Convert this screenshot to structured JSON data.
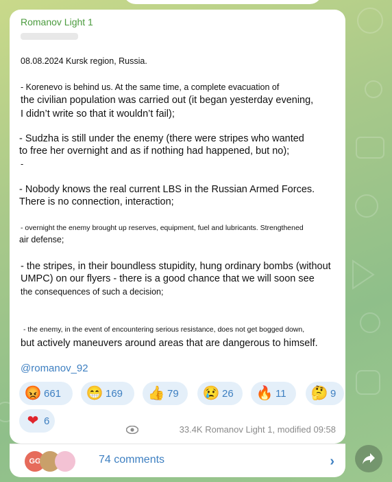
{
  "author": "Romanov Light 1",
  "lines": [
    {
      "text": "08.08.2024 Kursk region, Russia.",
      "size": "s12"
    },
    {
      "text": "- Korenevo is behind us. At the same time, a complete evacuation of",
      "size": "s12"
    },
    {
      "text": "the civilian population was carried out (it began yesterday evening,",
      "size": "s14"
    },
    {
      "text": "I didn’t write so that it wouldn’t fail);",
      "size": "s14"
    },
    {
      "text": "- Sudzha is still under the enemy (there were stripes who wanted",
      "size": "s14"
    },
    {
      "text": "to free her overnight and as if nothing had happened, but no);",
      "size": "s14"
    },
    {
      "text": "-",
      "size": "s12"
    },
    {
      "text": "- Nobody knows the real current LBS in the Russian Armed Forces.",
      "size": "s14"
    },
    {
      "text": "There is no connection, interaction;",
      "size": "s14"
    },
    {
      "text": "- overnight the enemy brought up reserves, equipment, fuel and lubricants. Strengthened",
      "size": "s10"
    },
    {
      "text": "air defense;",
      "size": "s12"
    },
    {
      "text": "- the stripes, in their boundless stupidity, hung ordinary bombs (without",
      "size": "s14"
    },
    {
      "text": "UMPC) on our flyers - there is a good chance that we will soon see",
      "size": "s14"
    },
    {
      "text": "the consequences of such a decision;",
      "size": "s12"
    },
    {
      "text": "- the enemy, in the event of encountering serious resistance, does not get bogged down,",
      "size": "s10"
    },
    {
      "text": "but actively maneuvers around areas that are dangerous to himself.",
      "size": "s14"
    }
  ],
  "handle": "@romanov_92",
  "reactions": [
    {
      "icon": "angry-face-icon",
      "emoji": "😡",
      "count": "661"
    },
    {
      "icon": "grinning-face-icon",
      "emoji": "😁",
      "count": "169"
    },
    {
      "icon": "thumbs-up-icon",
      "emoji": "👍",
      "count": "79"
    },
    {
      "icon": "crying-face-icon",
      "emoji": "😢",
      "count": "26"
    },
    {
      "icon": "fire-icon",
      "emoji": "🔥",
      "count": "11"
    },
    {
      "icon": "thinking-face-icon",
      "emoji": "🤔",
      "count": "9"
    },
    {
      "icon": "heart-icon",
      "emoji": "❤",
      "count": "6"
    }
  ],
  "meta": "33.4K Romanov Light 1, modified 09:58",
  "avatar_initials": "GG",
  "comments_label": "74 comments",
  "colors": {
    "accent": "#3d7fc1",
    "author": "#4b9b3e",
    "reaction_bg": "#e4eff9"
  }
}
